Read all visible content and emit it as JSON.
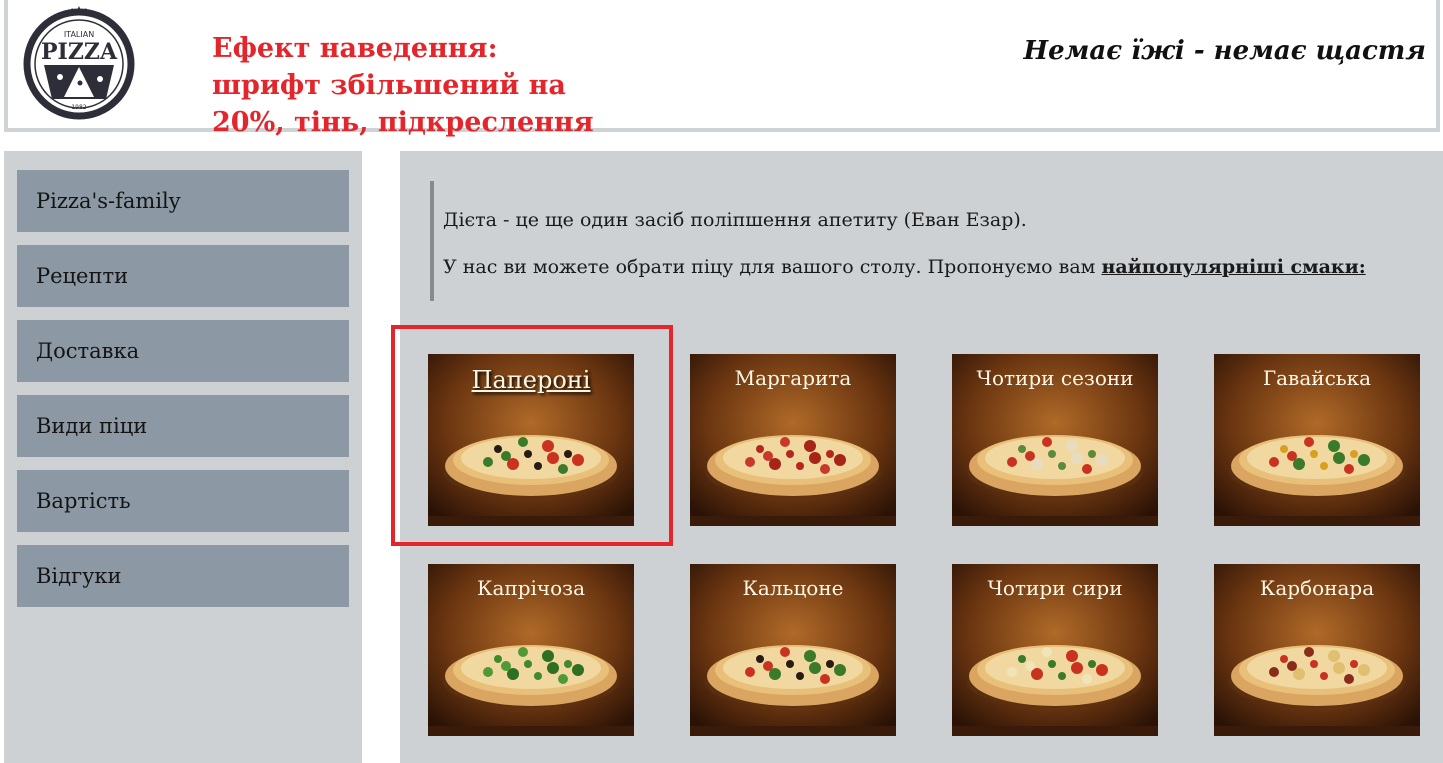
{
  "header": {
    "logo": {
      "top_text": "ITALIAN",
      "main_text": "PIZZA",
      "year_text": "1982"
    },
    "annotation_lines": [
      "Ефект наведення:",
      "шрифт збільшений на",
      "20%, тінь, підкреслення"
    ],
    "slogan": "Немає їжі - немає щастя",
    "annotation_color": "#e3262c"
  },
  "sidebar": {
    "items": [
      {
        "label": "Pizza's-family"
      },
      {
        "label": "Рецепти"
      },
      {
        "label": "Доставка"
      },
      {
        "label": "Види піци"
      },
      {
        "label": "Вартість"
      },
      {
        "label": "Відгуки"
      }
    ]
  },
  "main": {
    "quote_line1": "Дієта - це ще один засіб поліпшення апетиту (Еван Езар).",
    "quote_line2_prefix": "У нас ви можете обрати піцу для вашого столу. Пропонуємо вам ",
    "quote_line2_highlight": "найпопулярніші смаки:",
    "pizzas": [
      {
        "name": "Папероні",
        "hovered": true
      },
      {
        "name": "Маргарита",
        "hovered": false
      },
      {
        "name": "Чотири сезони",
        "hovered": false
      },
      {
        "name": "Гавайська",
        "hovered": false
      },
      {
        "name": "Капрічоза",
        "hovered": false
      },
      {
        "name": "Кальцоне",
        "hovered": false
      },
      {
        "name": "Чотири сири",
        "hovered": false
      },
      {
        "name": "Карбонара",
        "hovered": false
      }
    ]
  },
  "colors": {
    "panel_bg": "#cdd1d4",
    "menu_item_bg": "#8c99a4",
    "highlight_border": "#e3262c"
  }
}
